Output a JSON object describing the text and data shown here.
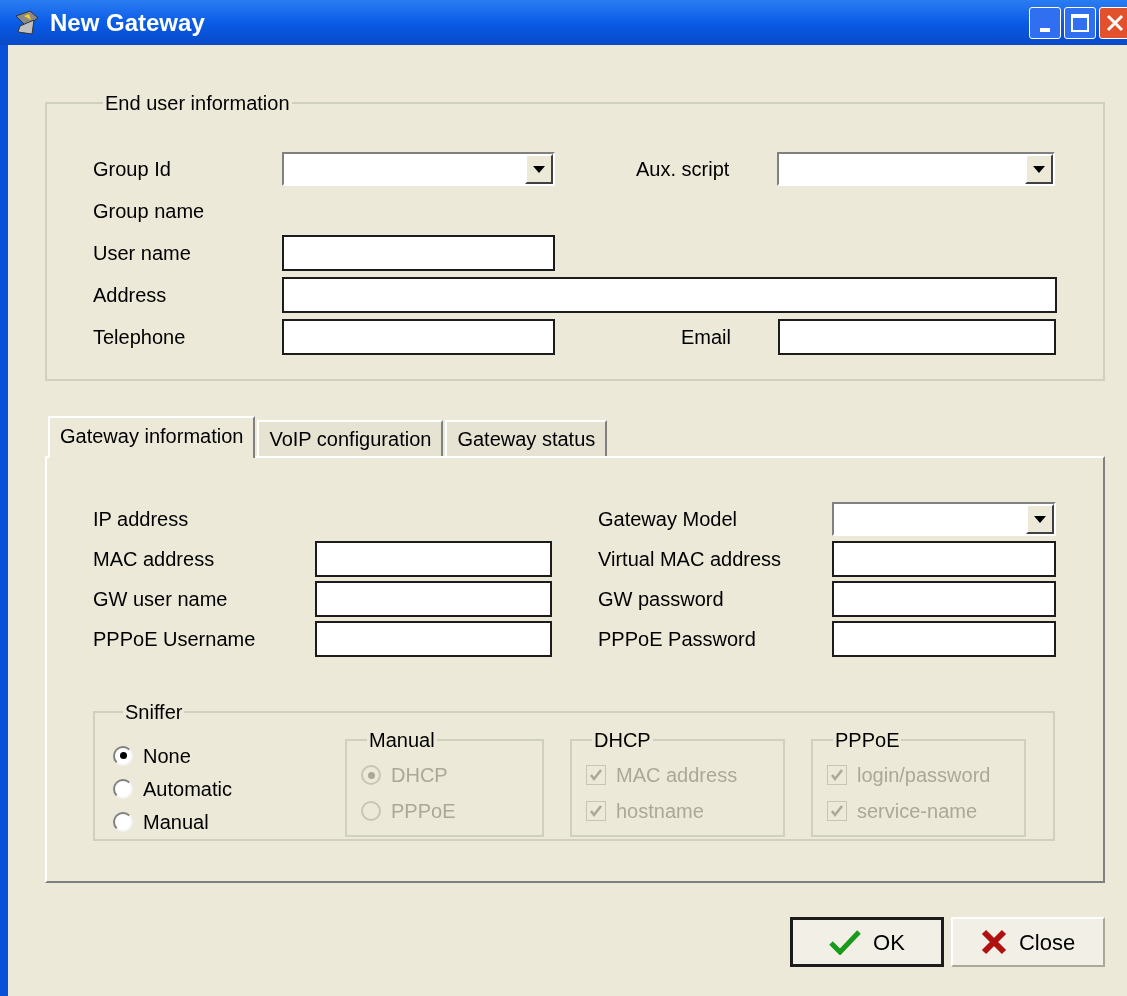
{
  "window": {
    "title": "New Gateway"
  },
  "end_user": {
    "legend": "End user information",
    "rows": [
      [
        {
          "label": "Group Id",
          "kind": "dropdown"
        },
        {
          "label": "Aux. script",
          "kind": "dropdown"
        }
      ],
      [
        {
          "label": "Group name",
          "kind": "none"
        }
      ],
      [
        {
          "label": "User name",
          "kind": "text"
        }
      ],
      [
        {
          "label": "Address",
          "kind": "wide"
        }
      ],
      [
        {
          "label": "Telephone",
          "kind": "text"
        },
        {
          "label": "Email",
          "kind": "text"
        }
      ]
    ]
  },
  "tabs": [
    {
      "label": "Gateway information",
      "selected": true
    },
    {
      "label": "VoIP configuration",
      "selected": false
    },
    {
      "label": "Gateway status",
      "selected": false
    }
  ],
  "gateway": {
    "rows": [
      [
        {
          "label": "IP address",
          "kind": "none"
        },
        {
          "label": "Gateway Model",
          "kind": "dropdown"
        }
      ],
      [
        {
          "label": "MAC address",
          "kind": "text"
        },
        {
          "label": "Virtual MAC address",
          "kind": "text"
        }
      ],
      [
        {
          "label": "GW user name",
          "kind": "text"
        },
        {
          "label": "GW password",
          "kind": "text"
        }
      ],
      [
        {
          "label": "PPPoE Username",
          "kind": "text"
        },
        {
          "label": "PPPoE Password",
          "kind": "text"
        }
      ]
    ]
  },
  "sniffer": {
    "legend": "Sniffer",
    "options": [
      {
        "label": "None",
        "selected": true
      },
      {
        "label": "Automatic",
        "selected": false
      },
      {
        "label": "Manual",
        "selected": false
      }
    ],
    "groups": [
      {
        "legend": "Manual",
        "kind": "radio",
        "disabled": true,
        "items": [
          {
            "label": "DHCP",
            "checked": true
          },
          {
            "label": "PPPoE",
            "checked": false
          }
        ]
      },
      {
        "legend": "DHCP",
        "kind": "checkbox",
        "disabled": true,
        "items": [
          {
            "label": "MAC address",
            "checked": true
          },
          {
            "label": "hostname",
            "checked": true
          }
        ]
      },
      {
        "legend": "PPPoE",
        "kind": "checkbox",
        "disabled": true,
        "items": [
          {
            "label": "login/password",
            "checked": true
          },
          {
            "label": "service-name",
            "checked": true
          }
        ]
      }
    ]
  },
  "buttons": [
    {
      "label": "OK",
      "kind": "ok",
      "default": true
    },
    {
      "label": "Close",
      "kind": "close",
      "default": false
    }
  ]
}
